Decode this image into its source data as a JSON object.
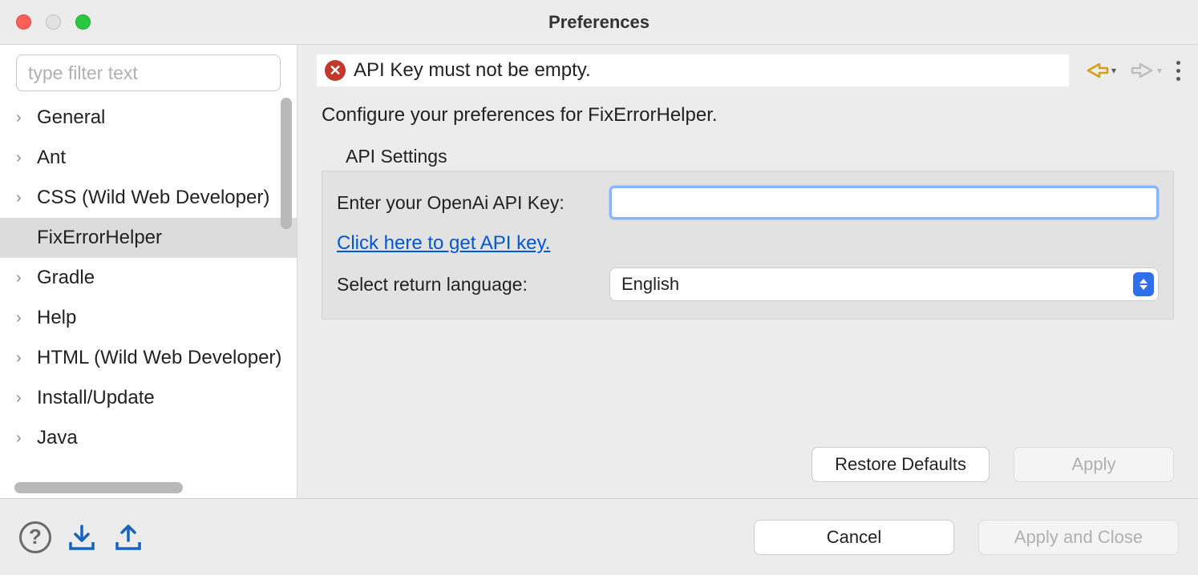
{
  "window": {
    "title": "Preferences"
  },
  "sidebar": {
    "filter_placeholder": "type filter text",
    "items": [
      {
        "label": "General",
        "expandable": true,
        "selected": false
      },
      {
        "label": "Ant",
        "expandable": true,
        "selected": false
      },
      {
        "label": "CSS (Wild Web Developer)",
        "expandable": true,
        "selected": false
      },
      {
        "label": "FixErrorHelper",
        "expandable": false,
        "selected": true
      },
      {
        "label": "Gradle",
        "expandable": true,
        "selected": false
      },
      {
        "label": "Help",
        "expandable": true,
        "selected": false
      },
      {
        "label": "HTML (Wild Web Developer)",
        "expandable": true,
        "selected": false
      },
      {
        "label": "Install/Update",
        "expandable": true,
        "selected": false
      },
      {
        "label": "Java",
        "expandable": true,
        "selected": false
      }
    ]
  },
  "panel": {
    "error_message": "API Key must not be empty.",
    "description": "Configure your preferences for FixErrorHelper.",
    "fieldset_title": "API Settings",
    "api_key_label": "Enter your OpenAi API Key:",
    "api_key_value": "",
    "api_key_link": "Click here to get API key.",
    "language_label": "Select return language:",
    "language_value": "English",
    "restore_defaults_label": "Restore Defaults",
    "apply_label": "Apply"
  },
  "footer": {
    "cancel_label": "Cancel",
    "apply_close_label": "Apply and Close"
  }
}
